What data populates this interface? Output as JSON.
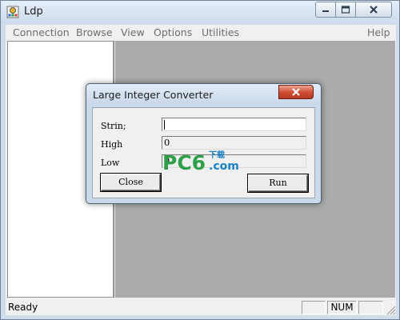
{
  "window": {
    "title": "Ldp"
  },
  "menu": {
    "items": [
      "Connection",
      "Browse",
      "View",
      "Options",
      "Utilities"
    ],
    "help": "Help"
  },
  "status": {
    "text": "Ready",
    "num": "NUM"
  },
  "dialog": {
    "title": "Large Integer Converter",
    "string_label": "Strin;",
    "high_label": "High",
    "low_label": "Low",
    "string_value": "",
    "high_value": "0",
    "low_value": "0",
    "close_label": "Close",
    "run_label": "Run"
  },
  "watermark": {
    "brand": "PC6",
    "suffix": ".com",
    "tag": "下载"
  },
  "colors": {
    "watermark_green": "#2fa04a",
    "watermark_blue": "#1e82c8",
    "close_red": "#c8452e"
  }
}
